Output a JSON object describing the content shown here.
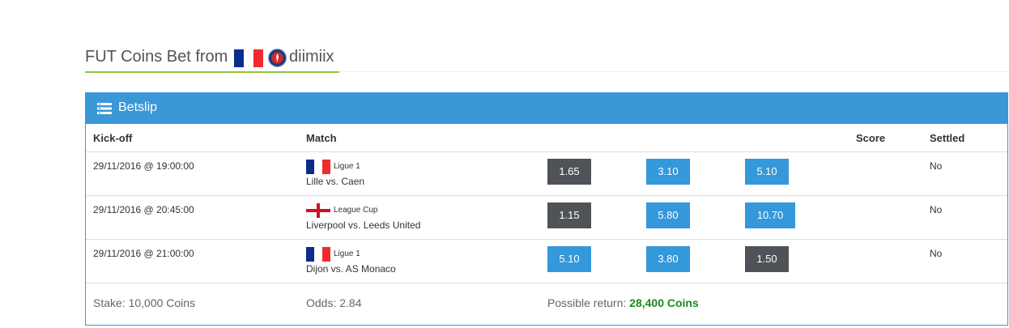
{
  "title": {
    "prefix": "FUT Coins Bet from",
    "username": "diimiix"
  },
  "panel": {
    "title": "Betslip"
  },
  "table": {
    "headers": {
      "kickoff": "Kick-off",
      "match": "Match",
      "score": "Score",
      "settled": "Settled"
    },
    "rows": [
      {
        "kickoff": "29/11/2016 @ 19:00:00",
        "league": "Ligue 1",
        "flag": "france-flag",
        "teams": "Lille vs. Caen",
        "odds": [
          "1.65",
          "3.10",
          "5.10"
        ],
        "selected": 0,
        "settled": "No"
      },
      {
        "kickoff": "29/11/2016 @ 20:45:00",
        "league": "League Cup",
        "flag": "england-flag",
        "teams": "Liverpool vs. Leeds United",
        "odds": [
          "1.15",
          "5.80",
          "10.70"
        ],
        "selected": 0,
        "settled": "No"
      },
      {
        "kickoff": "29/11/2016 @ 21:00:00",
        "league": "Ligue 1",
        "flag": "france-flag",
        "teams": "Dijon vs. AS Monaco",
        "odds": [
          "5.10",
          "3.80",
          "1.50"
        ],
        "selected": 2,
        "settled": "No"
      }
    ]
  },
  "footer": {
    "stake": "Stake: 10,000 Coins",
    "odds": "Odds: 2.84",
    "possible_return_label": "Possible return:",
    "possible_return_value": "28,400 Coins"
  },
  "colors": {
    "panel_blue": "#3a97d8",
    "odd_blue": "#3498db",
    "odd_selected": "#4f5357",
    "title_underline": "#8cc63f",
    "return_green": "#1a8a1a"
  }
}
